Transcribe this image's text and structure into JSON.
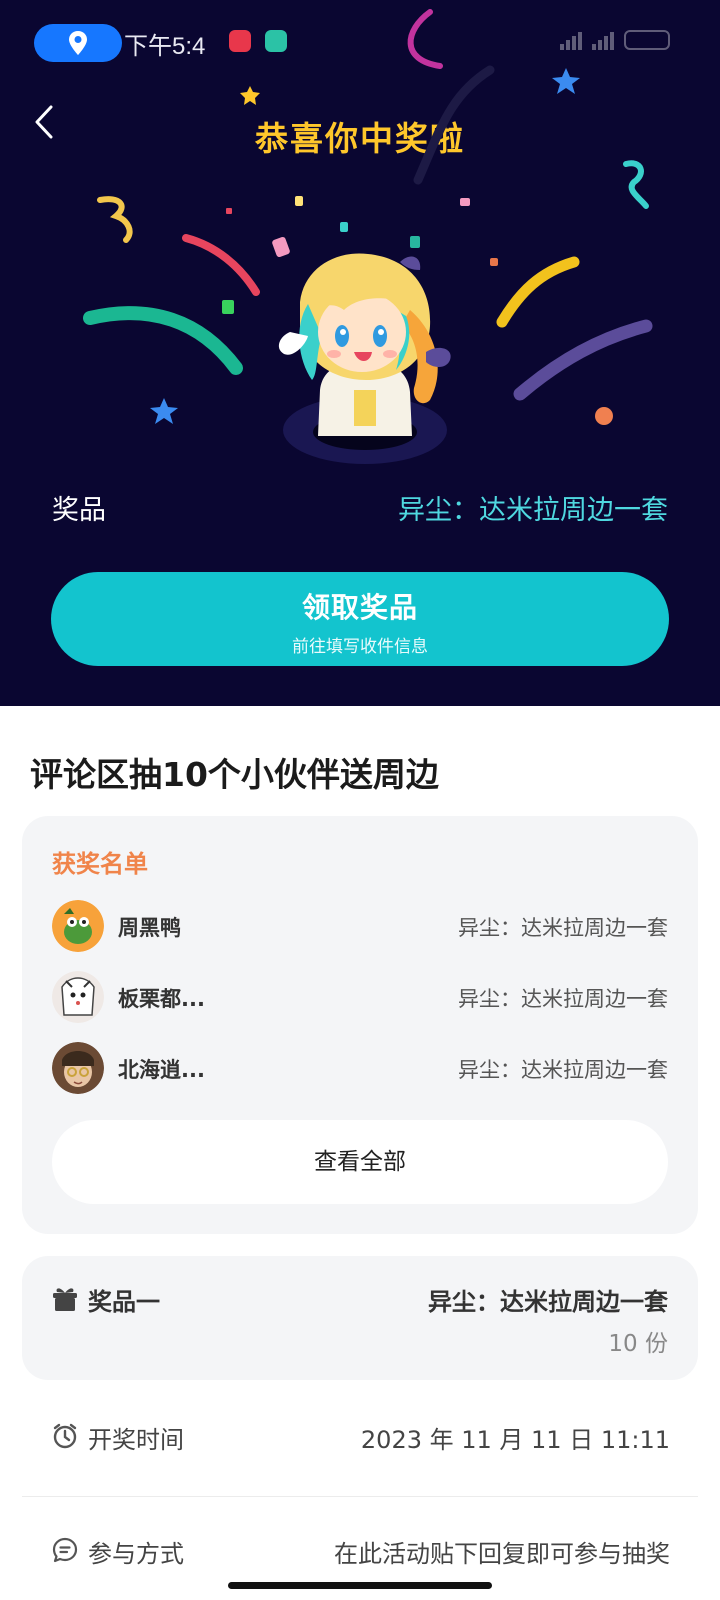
{
  "status_bar": {
    "time": "下午5:4",
    "icons": [
      "location-icon",
      "netease-music-icon",
      "shield-app-icon",
      "signal-icon",
      "wifi-icon",
      "battery-icon"
    ]
  },
  "header": {
    "title": "恭喜你中奖啦",
    "back_icon": "chevron-left-icon"
  },
  "prize": {
    "label": "奖品",
    "value": "异尘：达米拉周边一套"
  },
  "claim_button": {
    "label": "领取奖品",
    "sublabel": "前往填写收件信息"
  },
  "activity": {
    "title": "评论区抽10个小伙伴送周边"
  },
  "winners": {
    "title": "获奖名单",
    "list": [
      {
        "name": "周黑鸭",
        "prize": "异尘：达米拉周边一套"
      },
      {
        "name": "板栗都...",
        "prize": "异尘：达米拉周边一套"
      },
      {
        "name": "北海逍...",
        "prize": "异尘：达米拉周边一套"
      }
    ],
    "view_all_label": "查看全部"
  },
  "prize_tier": {
    "label": "奖品一",
    "value": "异尘：达米拉周边一套",
    "quantity": "10 份"
  },
  "draw_time": {
    "label": "开奖时间",
    "value": "2023 年 11 月 11 日 11:11"
  },
  "participation": {
    "label": "参与方式",
    "value": "在此活动贴下回复即可参与抽奖"
  },
  "colors": {
    "hero_bg": "#0a0631",
    "title_gold": "#ffc72b",
    "accent_teal": "#13c4ce",
    "prize_value_teal": "#4fd8e0",
    "winners_title_orange": "#f0844a"
  }
}
